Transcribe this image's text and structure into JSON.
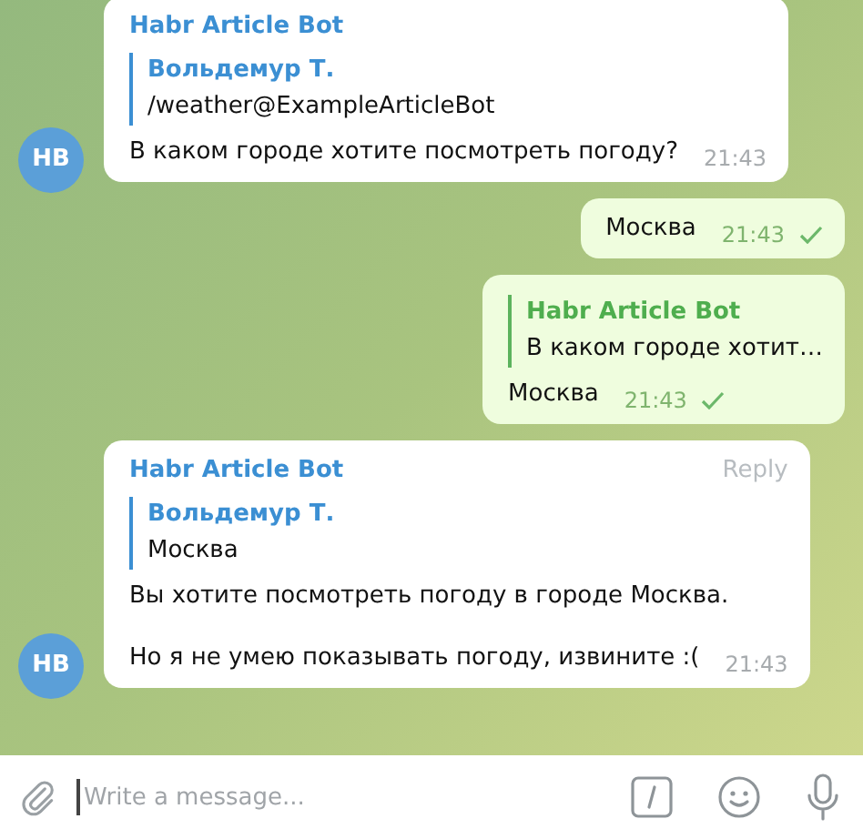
{
  "messages": [
    {
      "kind": "incoming",
      "sender": "Habr Article Bot",
      "avatar": "HB",
      "reply": {
        "author": "Вольдемур Т.",
        "text": "/weather@ExampleArticleBot"
      },
      "paragraphs": [
        "В каком городе хотите посмотреть погоду?"
      ],
      "time": "21:43"
    },
    {
      "kind": "outgoing",
      "paragraphs": [
        "Москва"
      ],
      "time": "21:43",
      "delivered": true
    },
    {
      "kind": "outgoing",
      "reply": {
        "author": "Habr Article Bot",
        "text": "В каком городе хотит…"
      },
      "paragraphs": [
        "Москва"
      ],
      "time": "21:43",
      "delivered": true
    },
    {
      "kind": "incoming",
      "sender": "Habr Article Bot",
      "action": "Reply",
      "avatar": "HB",
      "reply": {
        "author": "Вольдемур Т.",
        "text": "Москва"
      },
      "paragraphs": [
        "Вы хотите посмотреть погоду в городе Москва.",
        "Но я не умею показывать погоду, извините :("
      ],
      "time": "21:43"
    }
  ],
  "composer": {
    "placeholder": "Write a message..."
  }
}
